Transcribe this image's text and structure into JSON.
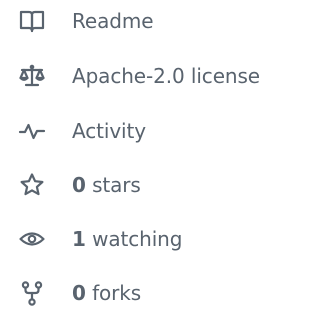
{
  "about": {
    "readme": {
      "label": "Readme",
      "icon": "book-icon"
    },
    "license": {
      "label": "Apache-2.0 license",
      "icon": "law-scale-icon"
    },
    "activity": {
      "label": "Activity",
      "icon": "pulse-icon"
    },
    "stars": {
      "count": "0",
      "label": "stars",
      "icon": "star-icon"
    },
    "watching": {
      "count": "1",
      "label": "watching",
      "icon": "eye-icon"
    },
    "forks": {
      "count": "0",
      "label": "forks",
      "icon": "fork-icon"
    }
  },
  "colors": {
    "text": "#59636e",
    "background": "#ffffff"
  }
}
